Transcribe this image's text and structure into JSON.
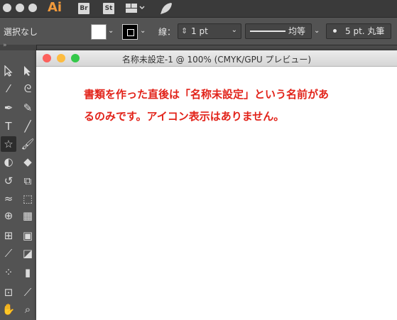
{
  "app_bar": {
    "app_name": "Ai",
    "badges": [
      "Br",
      "St"
    ]
  },
  "control_bar": {
    "selection_label": "選択なし",
    "stroke_label": "線：",
    "stroke_weight": "1 pt",
    "stroke_profile": "均等",
    "brush": "5 pt. 丸筆"
  },
  "document": {
    "title": "名称未設定-1 @ 100% (CMYK/GPU プレビュー)"
  },
  "annotation": {
    "line1": "書類を作った直後は「名称未設定」という名前があ",
    "line2": "るのみです。アイコン表示はありません。"
  },
  "colors": {
    "annotation_red": "#e2231a",
    "ai_orange": "#f29a3b",
    "close": "#fc605c",
    "minimize": "#fdbc40",
    "zoom": "#34c84a"
  }
}
